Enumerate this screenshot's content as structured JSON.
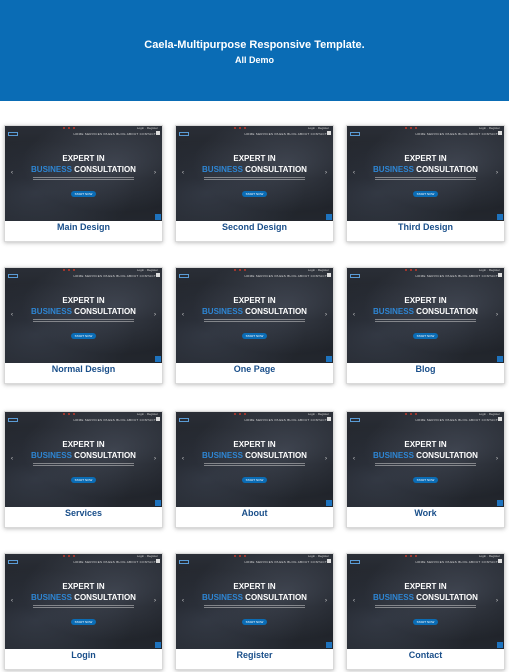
{
  "header": {
    "title": "Caela-Multipurpose Responsive Template.",
    "subtitle": "All Demo"
  },
  "preview": {
    "heading_line1": "EXPERT IN",
    "heading_accent": "BUSINESS",
    "heading_line2": "CONSULTATION",
    "cta": "START NOW",
    "nav": "HOME   SERVICES   PAGES   BLOG   ABOUT   CONTACT",
    "login": "Login  ·  Register",
    "arrow_left": "‹",
    "arrow_right": "›"
  },
  "demos": [
    {
      "label": "Main Design"
    },
    {
      "label": "Second Design"
    },
    {
      "label": "Third Design"
    },
    {
      "label": "Normal Design"
    },
    {
      "label": "One Page"
    },
    {
      "label": "Blog"
    },
    {
      "label": "Services"
    },
    {
      "label": "About"
    },
    {
      "label": "Work"
    },
    {
      "label": "Login"
    },
    {
      "label": "Register"
    },
    {
      "label": "Contact"
    }
  ],
  "colors": {
    "header_bg": "#0a6cb5",
    "label": "#1a4f8a",
    "accent": "#2e86d4"
  }
}
